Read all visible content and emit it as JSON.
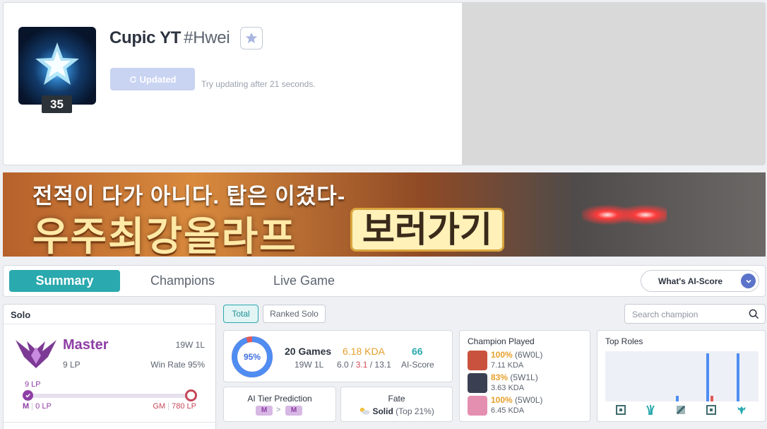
{
  "profile": {
    "name": "Cupic YT",
    "tag": "#Hwei",
    "level": "35",
    "update_button": "Updated",
    "update_note": "Try updating after 21 seconds."
  },
  "banner": {
    "line1": "전적이 다가 아니다. 탑은 이겼다-",
    "line2": "우주최강올라프",
    "cta": "보러가기"
  },
  "tabs": {
    "summary": "Summary",
    "champions": "Champions",
    "live_game": "Live Game",
    "ai_score": "What's AI-Score"
  },
  "solo": {
    "header": "Solo",
    "tier": "Master",
    "lp": "9 LP",
    "record": "19W 1L",
    "win_rate": "Win Rate 95%",
    "progress_label": "9 LP",
    "progress_fraction": 0.0115,
    "left_rank": "M",
    "left_lp": "0 LP",
    "right_rank": "GM",
    "right_lp": "780 LP"
  },
  "filters": {
    "total": "Total",
    "ranked_solo": "Ranked Solo",
    "search_placeholder": "Search champion"
  },
  "summary": {
    "win_pct": "95%",
    "win_fraction": 0.95,
    "games": "20 Games",
    "record": "19W 1L",
    "kda": "6.18 KDA",
    "kills": "6.0",
    "deaths": "3.1",
    "assists": "13.1",
    "ai_score": "66",
    "ai_score_label": "AI-Score"
  },
  "prediction": {
    "title": "AI Tier Prediction",
    "from": "M",
    "to": "M"
  },
  "fate": {
    "title": "Fate",
    "value": "Solid",
    "detail": "(Top 21%)"
  },
  "champion_played": {
    "title": "Champion Played",
    "rows": [
      {
        "wr": "100%",
        "record": "(6W0L)",
        "kda": "7.11 KDA",
        "color": "#c9523e"
      },
      {
        "wr": "83%",
        "record": "(5W1L)",
        "kda": "3.63 KDA",
        "color": "#3a3f52"
      },
      {
        "wr": "100%",
        "record": "(5W0L)",
        "kda": "6.45 KDA",
        "color": "#e58fb0"
      }
    ]
  },
  "top_roles": {
    "title": "Top Roles",
    "roles": [
      {
        "icon": "top-role-icon",
        "games": 0,
        "losses": 0
      },
      {
        "icon": "jungle-role-icon",
        "games": 0,
        "losses": 0
      },
      {
        "icon": "mid-role-icon",
        "games": 1,
        "losses": 0
      },
      {
        "icon": "bot-role-icon",
        "games": 9,
        "losses": 1
      },
      {
        "icon": "support-role-icon",
        "games": 9,
        "losses": 0
      }
    ],
    "max_games": 9
  },
  "colors": {
    "accent": "#2aa9ae",
    "master": "#8e3ea5",
    "gm": "#c6475a",
    "kda": "#e7a02b"
  }
}
